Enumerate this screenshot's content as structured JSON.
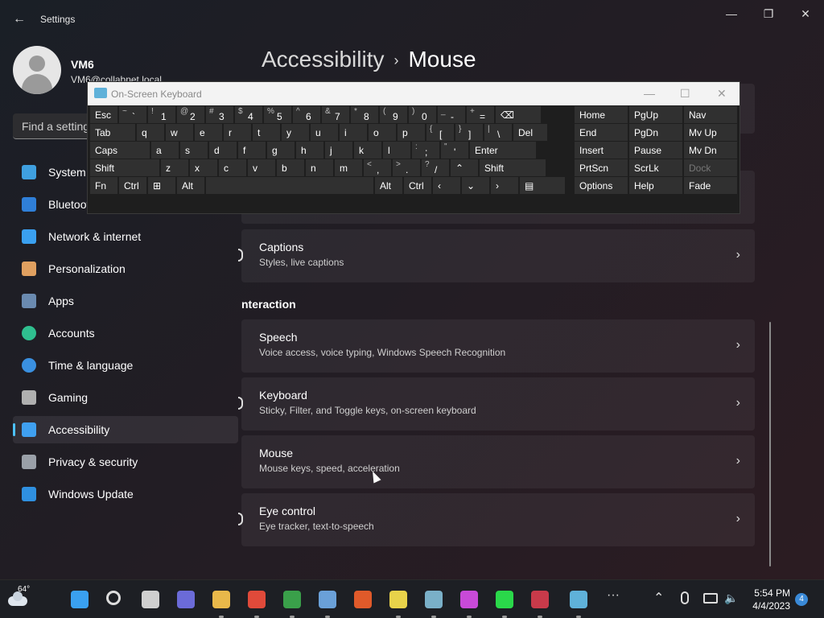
{
  "window": {
    "title": "Settings",
    "back": "←",
    "minimize": "—",
    "maximize": "❐",
    "close": "✕"
  },
  "profile": {
    "name": "VM6",
    "email": "VM6@collabnet.local"
  },
  "search": {
    "placeholder": "Find a setting"
  },
  "nav": [
    {
      "label": "System",
      "icon": "monitor-icon",
      "color": "#3fa0e0"
    },
    {
      "label": "Bluetooth & devices",
      "icon": "bluetooth-icon",
      "color": "#2f7fd8"
    },
    {
      "label": "Network & internet",
      "icon": "wifi-icon",
      "color": "#3aa0f0"
    },
    {
      "label": "Personalization",
      "icon": "brush-icon",
      "color": "#e0a060"
    },
    {
      "label": "Apps",
      "icon": "apps-icon",
      "color": "#6a8ab0"
    },
    {
      "label": "Accounts",
      "icon": "person-icon",
      "color": "#2fbf8f"
    },
    {
      "label": "Time & language",
      "icon": "clock-globe-icon",
      "color": "#3a90e0"
    },
    {
      "label": "Gaming",
      "icon": "gamepad-icon",
      "color": "#b0b0b0"
    },
    {
      "label": "Accessibility",
      "icon": "accessibility-icon",
      "color": "#3fa0f0"
    },
    {
      "label": "Privacy & security",
      "icon": "shield-icon",
      "color": "#9aa0a8"
    },
    {
      "label": "Windows Update",
      "icon": "update-icon",
      "color": "#2f90e0"
    }
  ],
  "breadcrumb": {
    "parent": "Accessibility",
    "separator": "›",
    "current": "Mouse"
  },
  "cards": [
    {
      "title": "Captions",
      "subtitle": "Styles, live captions"
    },
    {
      "title": "Speech",
      "subtitle": "Voice access, voice typing, Windows Speech Recognition"
    },
    {
      "title": "Keyboard",
      "subtitle": "Sticky, Filter, and Toggle keys, on-screen keyboard"
    },
    {
      "title": "Mouse",
      "subtitle": "Mouse keys, speed, acceleration"
    },
    {
      "title": "Eye control",
      "subtitle": "Eye tracker, text-to-speech"
    }
  ],
  "section_interaction": "nteraction",
  "chevron": "›",
  "osk": {
    "title": "On-Screen Keyboard",
    "rows": [
      [
        {
          "m": "Esc"
        },
        {
          "s": "~",
          "n": "`"
        },
        {
          "s": "!",
          "n": "1"
        },
        {
          "s": "@",
          "n": "2"
        },
        {
          "s": "#",
          "n": "3"
        },
        {
          "s": "$",
          "n": "4"
        },
        {
          "s": "%",
          "n": "5"
        },
        {
          "s": "^",
          "n": "6"
        },
        {
          "s": "&",
          "n": "7"
        },
        {
          "s": "*",
          "n": "8"
        },
        {
          "s": "(",
          "n": "9"
        },
        {
          "s": ")",
          "n": "0"
        },
        {
          "s": "_",
          "n": "-"
        },
        {
          "s": "+",
          "n": "="
        },
        {
          "m": "⌫"
        }
      ],
      [
        {
          "m": "Tab"
        },
        {
          "m": "q"
        },
        {
          "m": "w"
        },
        {
          "m": "e"
        },
        {
          "m": "r"
        },
        {
          "m": "t"
        },
        {
          "m": "y"
        },
        {
          "m": "u"
        },
        {
          "m": "i"
        },
        {
          "m": "o"
        },
        {
          "m": "p"
        },
        {
          "s": "{",
          "n": "["
        },
        {
          "s": "}",
          "n": "]"
        },
        {
          "s": "|",
          "n": "\\"
        },
        {
          "m": "Del"
        }
      ],
      [
        {
          "m": "Caps"
        },
        {
          "m": "a"
        },
        {
          "m": "s"
        },
        {
          "m": "d"
        },
        {
          "m": "f"
        },
        {
          "m": "g"
        },
        {
          "m": "h"
        },
        {
          "m": "j"
        },
        {
          "m": "k"
        },
        {
          "m": "l"
        },
        {
          "s": ":",
          "n": ";"
        },
        {
          "s": "\"",
          "n": "'"
        },
        {
          "m": "Enter"
        }
      ],
      [
        {
          "m": "Shift"
        },
        {
          "m": "z"
        },
        {
          "m": "x"
        },
        {
          "m": "c"
        },
        {
          "m": "v"
        },
        {
          "m": "b"
        },
        {
          "m": "n"
        },
        {
          "m": "m"
        },
        {
          "s": "<",
          "n": ","
        },
        {
          "s": ">",
          "n": "."
        },
        {
          "s": "?",
          "n": "/"
        },
        {
          "m": "⌃"
        },
        {
          "m": "Shift"
        }
      ],
      [
        {
          "m": "Fn"
        },
        {
          "m": "Ctrl"
        },
        {
          "m": "⊞"
        },
        {
          "m": "Alt"
        },
        {
          "m": ""
        },
        {
          "m": "Alt"
        },
        {
          "m": "Ctrl"
        },
        {
          "m": "‹"
        },
        {
          "m": "⌄"
        },
        {
          "m": "›"
        },
        {
          "m": "▤"
        }
      ]
    ],
    "nav_rows": [
      [
        "Home",
        "PgUp",
        "Nav"
      ],
      [
        "End",
        "PgDn",
        "Mv Up"
      ],
      [
        "Insert",
        "Pause",
        "Mv Dn"
      ],
      [
        "PrtScn",
        "ScrLk",
        "Dock"
      ],
      [
        "Options",
        "Help",
        "Fade"
      ]
    ]
  },
  "taskbar": {
    "temp": "64°",
    "time": "5:54 PM",
    "date": "4/4/2023",
    "badge": "4",
    "more": "···",
    "chevron_up": "⌃"
  }
}
